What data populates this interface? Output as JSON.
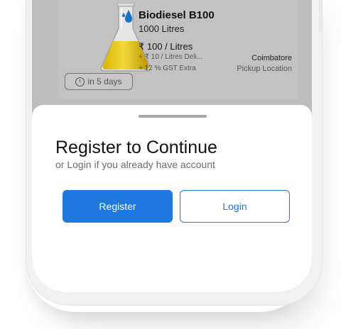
{
  "product": {
    "name": "Biodiesel B100",
    "quantity": "1000 Litres",
    "price": "₹ 100 / Litres",
    "delivery": "+ ₹ 10 / Litres Deli...",
    "gst": "+ 12 % GST Extra",
    "city": "Coimbatore",
    "pickup_label": "Pickup Location",
    "eta": "in 5 days",
    "icons": {
      "product_image": "flask-icon",
      "category": "drop-icon",
      "eta": "clock-icon"
    }
  },
  "sheet": {
    "title": "Register to Continue",
    "subtitle": "or Login if you already have account",
    "register_label": "Register",
    "login_label": "Login"
  },
  "colors": {
    "accent": "#1e78e0",
    "overlay": "#bdbdbd",
    "sheet_bg": "#ffffff"
  }
}
